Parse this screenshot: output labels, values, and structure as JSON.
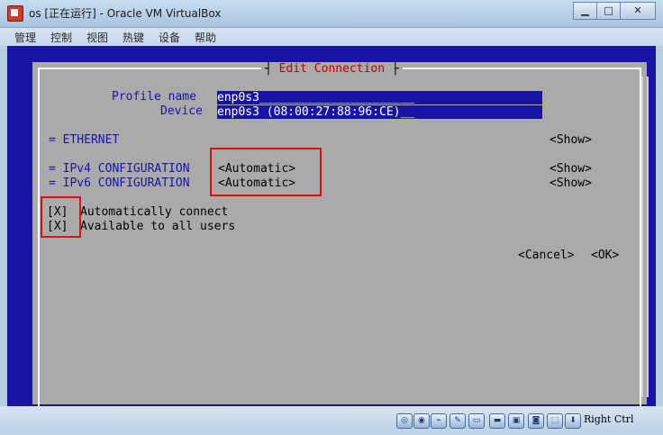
{
  "window": {
    "title": "os [正在运行] - Oracle VM VirtualBox",
    "buttons": {
      "minimize": "▁",
      "maximize": "□",
      "close": "✕"
    }
  },
  "menubar": {
    "items": [
      "管理",
      "控制",
      "视图",
      "热键",
      "设备",
      "帮助"
    ]
  },
  "dialog": {
    "title": "Edit Connection",
    "profile_name_label": "Profile name",
    "profile_name_value": "enp0s3______________________",
    "device_label": "Device",
    "device_value": "enp0s3 (08:00:27:88:96:CE)__",
    "ethernet_label": "= ETHERNET",
    "ethernet_show": "<Show>",
    "ipv4_label": "= IPv4 CONFIGURATION",
    "ipv4_mode": "<Automatic>",
    "ipv4_show": "<Show>",
    "ipv6_label": "= IPv6 CONFIGURATION",
    "ipv6_mode": "<Automatic>",
    "ipv6_show": "<Show>",
    "auto_connect_check": "[X]",
    "auto_connect_label": "Automatically connect",
    "all_users_check": "[X]",
    "all_users_label": "Available to all users",
    "cancel": "<Cancel>",
    "ok": "<OK>"
  },
  "statusbar": {
    "icons": [
      "hard-disk-icon",
      "optical-disc-icon",
      "usb-icon",
      "shared-folders-icon",
      "display-icon",
      "network-icon",
      "recording-icon",
      "cpu-icon",
      "mouse-integration-icon"
    ],
    "host_key": "Right Ctrl"
  },
  "colors": {
    "vm_blue": "#1a14a6",
    "dialog_gray": "#aaaaaa",
    "title_red": "#c40000",
    "highlight_red": "#e01010"
  }
}
